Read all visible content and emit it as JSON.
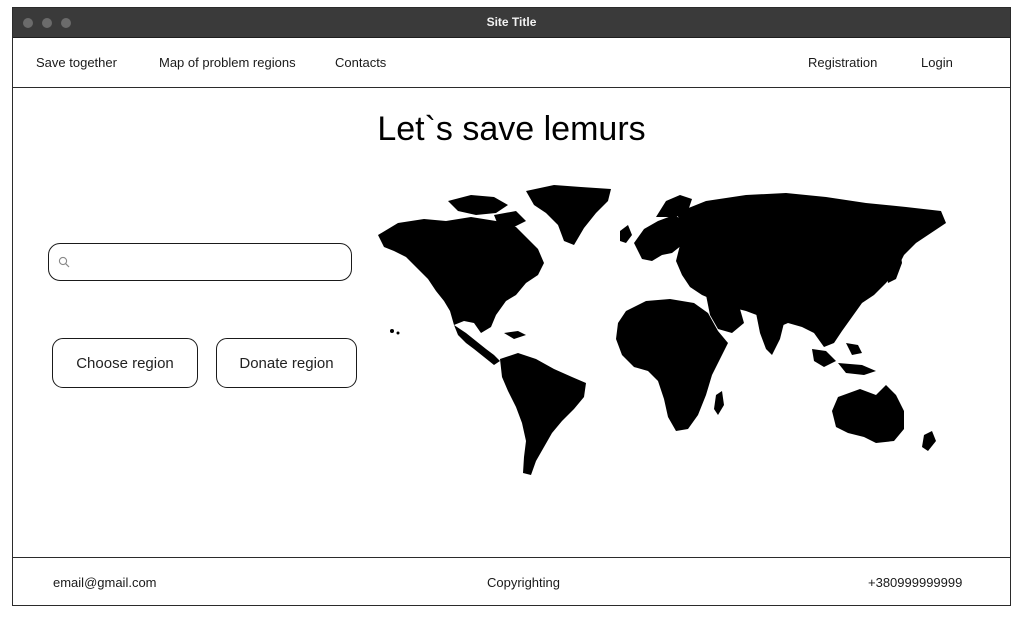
{
  "window": {
    "title": "Site Title"
  },
  "nav": {
    "left": [
      "Save together",
      "Map of problem regions",
      "Contacts"
    ],
    "right": [
      "Registration",
      "Login"
    ]
  },
  "main": {
    "headline": "Let`s save lemurs",
    "search": {
      "value": "",
      "placeholder": ""
    },
    "buttons": {
      "choose": "Choose region",
      "donate": "Donate region"
    },
    "map_icon": "world-map"
  },
  "footer": {
    "email": "email@gmail.com",
    "copyright": "Copyrighting",
    "phone": "+380999999999"
  }
}
